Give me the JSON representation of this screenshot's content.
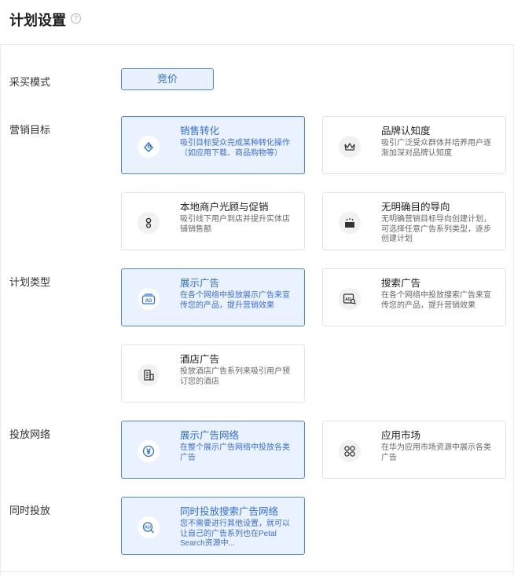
{
  "header": {
    "title": "计划设置",
    "help_icon": "?"
  },
  "sections": {
    "buy_mode": {
      "label": "采买模式",
      "option": "竞价"
    },
    "goal": {
      "label": "营销目标"
    },
    "plan_type": {
      "label": "计划类型"
    },
    "network": {
      "label": "投放网络"
    },
    "simultaneous": {
      "label": "同时投放"
    }
  },
  "cards": {
    "sales": {
      "title": "销售转化",
      "desc": "吸引目标受众完成某种转化操作（如应用下载、商品购物等）",
      "icon": "target-icon"
    },
    "brand": {
      "title": "品牌认知度",
      "desc": "吸引广泛受众群体并培养用户逐渐加深对品牌认知度",
      "icon": "crown-icon"
    },
    "local": {
      "title": "本地商户光顾与促销",
      "desc": "吸引线下用户到店并提升实体店铺销售额",
      "icon": "store-person-icon"
    },
    "noguide": {
      "title": "无明确目的导向",
      "desc": "无明确营销目标导向创建计划，可选择任意广告系列类型，逐步创建计划",
      "icon": "box-icon"
    },
    "display": {
      "title": "展示广告",
      "desc": "在各个网络中投放展示广告来宣传您的产品，提升营销效果",
      "icon": "ad-icon"
    },
    "search": {
      "title": "搜索广告",
      "desc": "在各个网络中投放搜索广告来宣传您的产品，提升营销效果",
      "icon": "ad-search-icon"
    },
    "hotel": {
      "title": "酒店广告",
      "desc": "投放酒店广告系列来吸引用户预订您的酒店",
      "icon": "hotel-icon"
    },
    "display_net": {
      "title": "展示广告网络",
      "desc": "在整个展示广告网络中投放各类广告",
      "icon": "yen-icon"
    },
    "appmarket": {
      "title": "应用市场",
      "desc": "在华为应用市场资源中展示各类广告",
      "icon": "apps-icon"
    },
    "search_net": {
      "title": "同时投放搜索广告网络",
      "desc": "您不需要进行其他设置，就可以让自己的广告系列也在Petal Search资源中...",
      "icon": "ad-search-icon"
    }
  },
  "colors": {
    "accent": "#2f6fe0",
    "selected_bg": "#eaf2ff",
    "selected_border": "#4b86f0"
  }
}
